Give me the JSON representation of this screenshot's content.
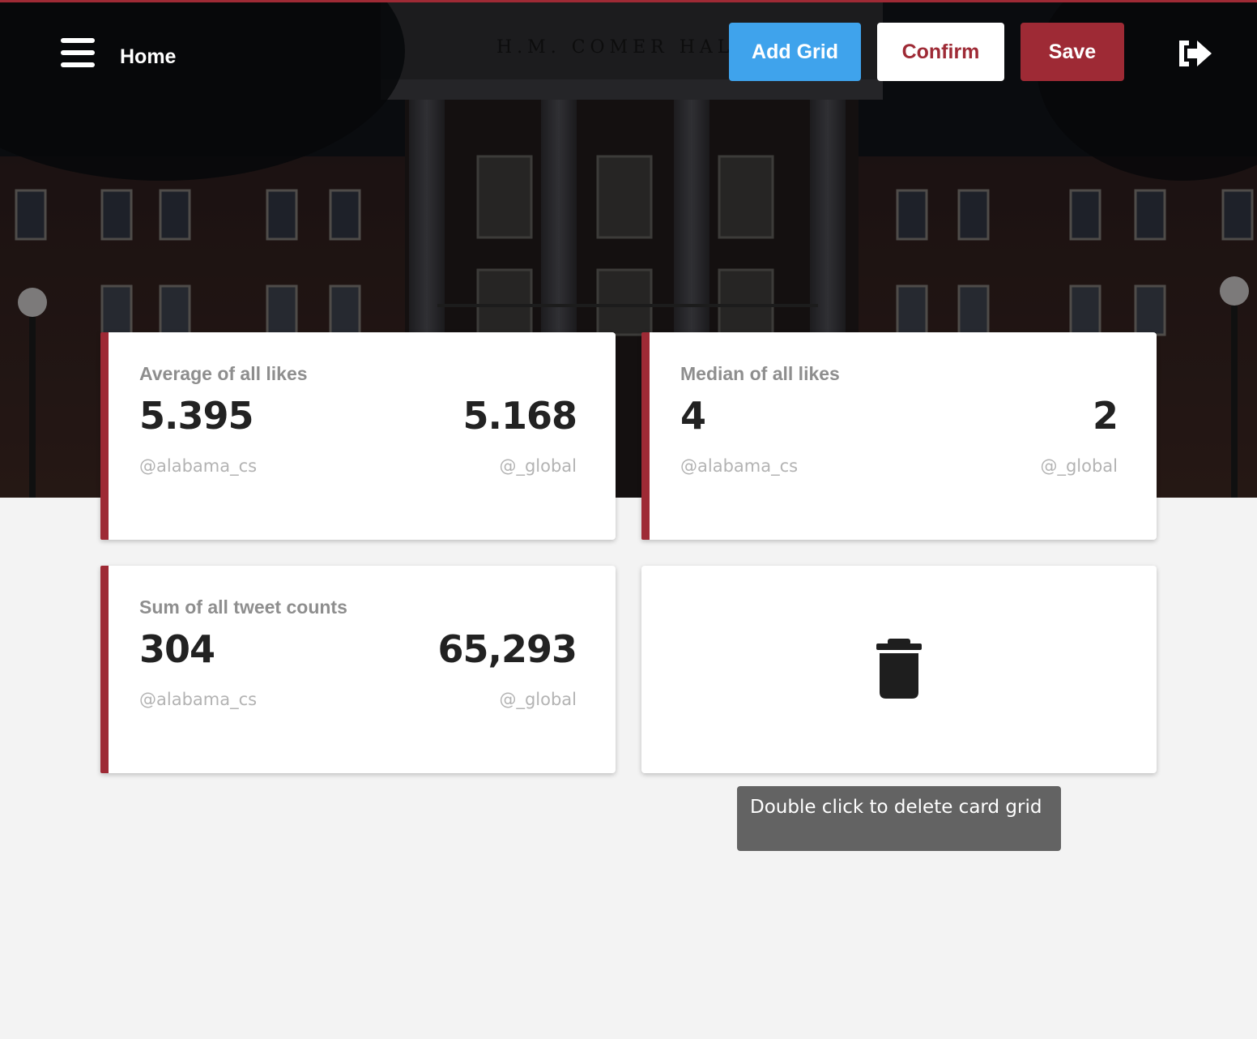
{
  "header": {
    "menu_icon": "hamburger-menu-icon",
    "home_label": "Home",
    "building_inscription": "H.M. COMER HALL",
    "logout_icon": "sign-out-icon"
  },
  "toolbar": {
    "add_grid_label": "Add Grid",
    "confirm_label": "Confirm",
    "save_label": "Save"
  },
  "colors": {
    "brand": "#9e2a35",
    "accent_blue": "#3fa3ec",
    "page_background": "#f3f3f3"
  },
  "cards": [
    {
      "title": "Average of all likes",
      "left_value": "5.395",
      "right_value": "5.168",
      "left_label": "@alabama_cs",
      "right_label": "@_global"
    },
    {
      "title": "Median of all likes",
      "left_value": "4",
      "right_value": "2",
      "left_label": "@alabama_cs",
      "right_label": "@_global"
    },
    {
      "title": "Sum of all tweet counts",
      "left_value": "304",
      "right_value": "65,293",
      "left_label": "@alabama_cs",
      "right_label": "@_global"
    }
  ],
  "delete_card": {
    "icon": "trash-icon",
    "tooltip": "Double click to delete card grid"
  }
}
